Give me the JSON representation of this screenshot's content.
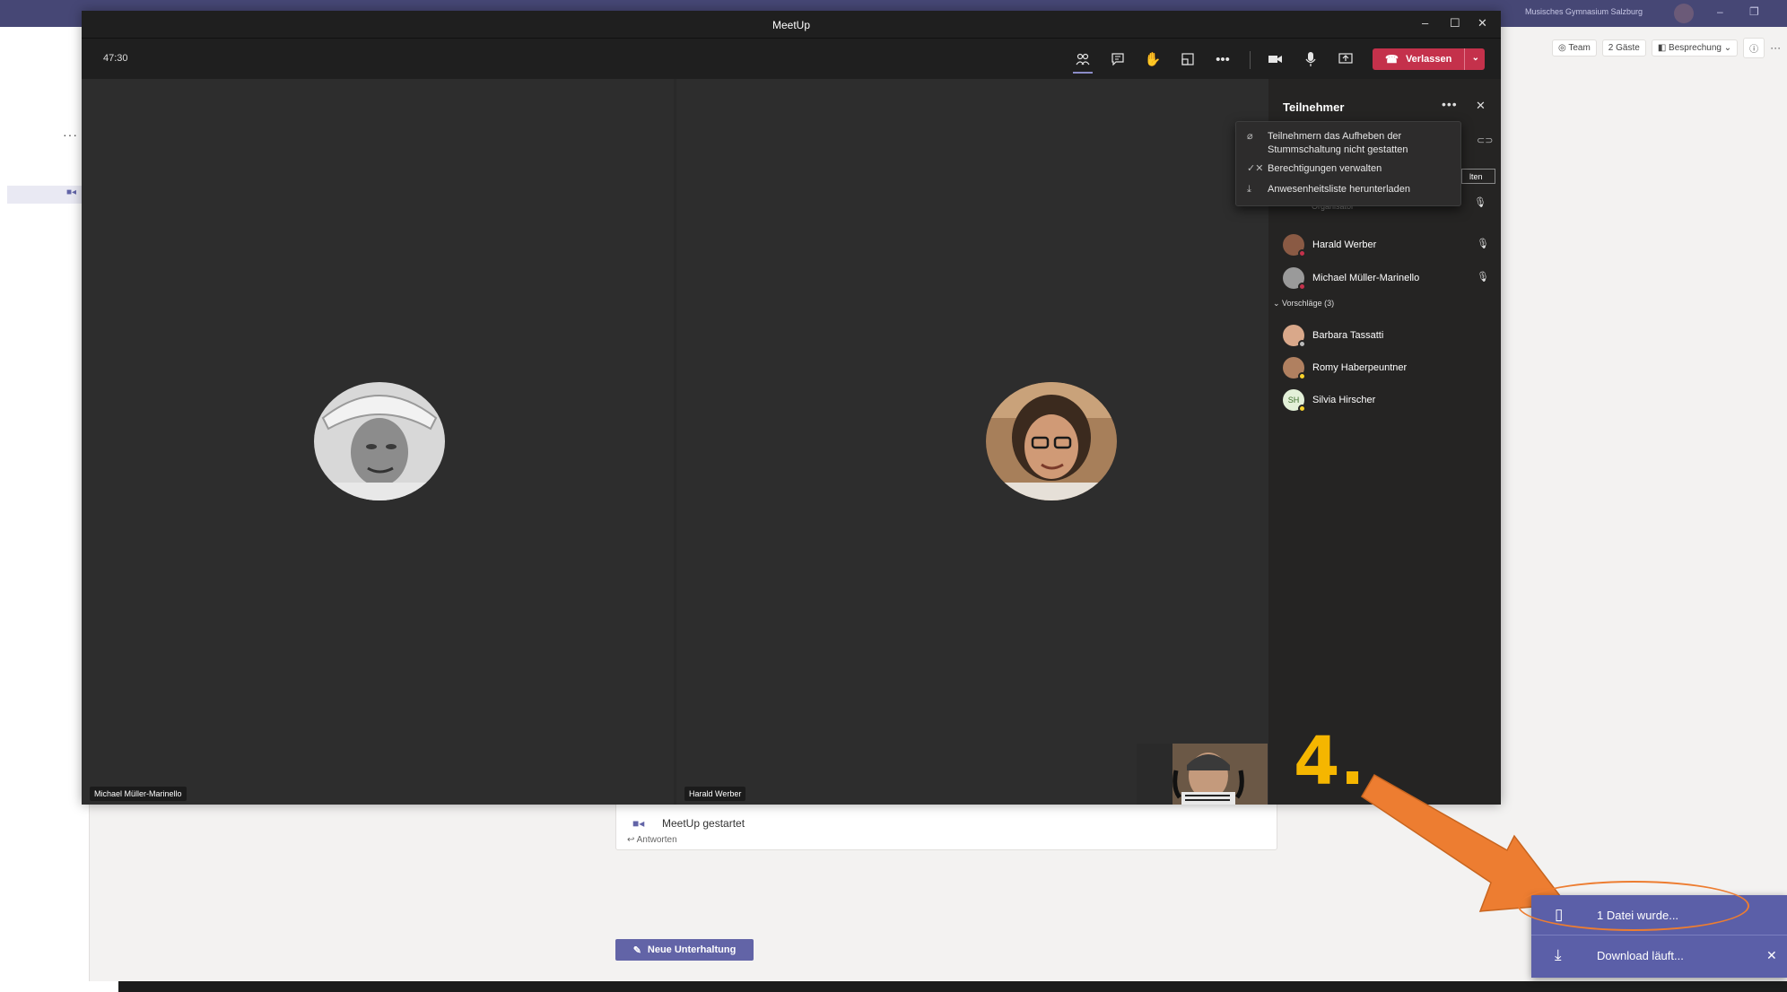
{
  "background": {
    "org_name": "Musisches Gymnasium Salzburg",
    "toolbar": {
      "team": "Team",
      "guests": "2 Gäste",
      "meeting": "Besprechung"
    },
    "post": {
      "title": "MeetUp gestartet",
      "reply": "Antworten"
    },
    "new_conversation": "Neue Unterhaltung"
  },
  "meeting": {
    "window_title": "MeetUp",
    "timer": "47:30",
    "leave_label": "Verlassen",
    "tiles": [
      {
        "name": "Michael Müller-Marinello"
      },
      {
        "name": "Harald Werber"
      }
    ]
  },
  "participants_panel": {
    "title": "Teilnehmer",
    "organizer_label": "Organisator",
    "header_button": "lten",
    "in_meeting": [
      {
        "name": "Harald Werber"
      },
      {
        "name": "Michael Müller-Marinello"
      }
    ],
    "suggestions_header": "Vorschläge (3)",
    "suggestions": [
      {
        "name": "Barbara Tassatti",
        "initials": ""
      },
      {
        "name": "Romy Haberpeuntner",
        "initials": ""
      },
      {
        "name": "Silvia Hirscher",
        "initials": "SH"
      }
    ],
    "menu": [
      "Teilnehmern das Aufheben der Stummschaltung nicht gestatten",
      "Berechtigungen verwalten",
      "Anwesenheitsliste herunterladen"
    ]
  },
  "annotation": {
    "step": "4."
  },
  "toast": {
    "file_text": "1 Datei wurde...",
    "download_text": "Download läuft..."
  },
  "colors": {
    "accent": "#6264a7",
    "leave": "#c4314b",
    "annotation": "#f5b600",
    "arrow": "#ed7d31"
  }
}
